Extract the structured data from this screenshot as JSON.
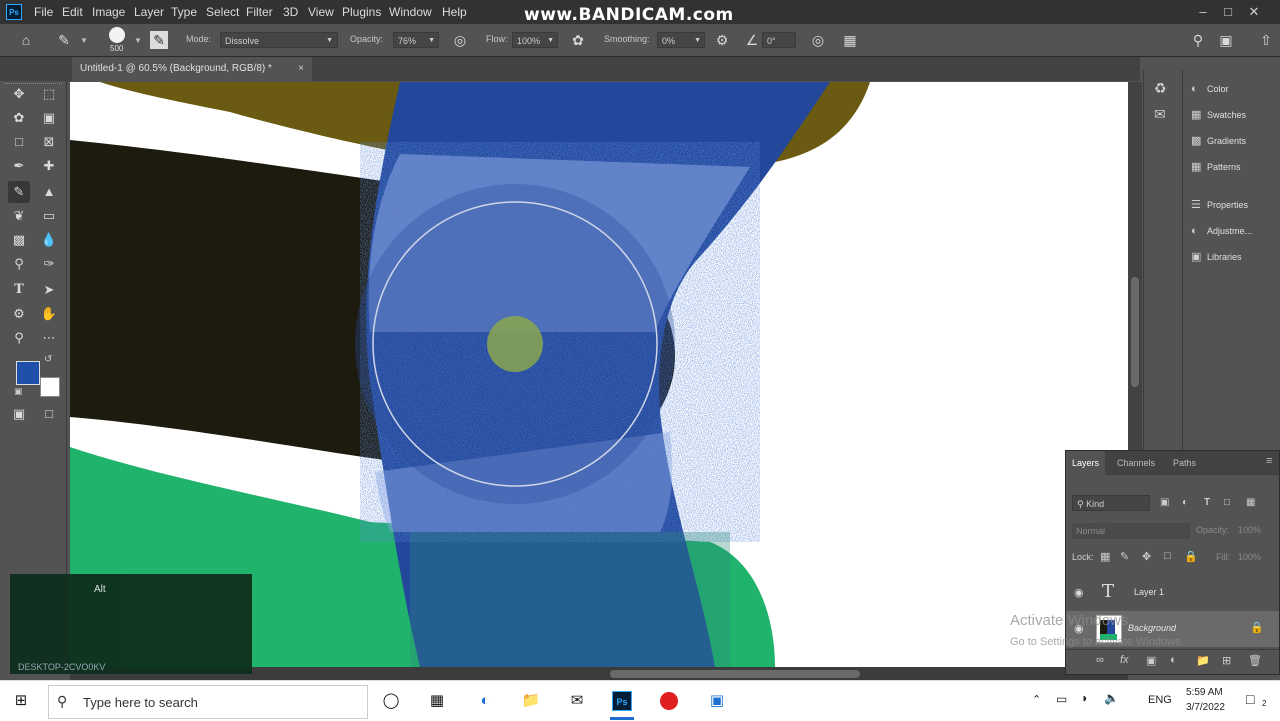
{
  "watermark": "www.BANDICAM.com",
  "menu": {
    "app_icon": "Ps",
    "items": [
      "File",
      "Edit",
      "Image",
      "Layer",
      "Type",
      "Select",
      "Filter",
      "3D",
      "View",
      "Plugins",
      "Window",
      "Help"
    ]
  },
  "options": {
    "brush_size": "500",
    "mode_label": "Mode:",
    "mode_value": "Dissolve",
    "opacity_label": "Opacity:",
    "opacity_value": "76%",
    "flow_label": "Flow:",
    "flow_value": "100%",
    "smoothing_label": "Smoothing:",
    "smoothing_value": "0%",
    "angle_value": "0°"
  },
  "document": {
    "tab_title": "Untitled-1 @ 60.5% (Background, RGB/8) *",
    "close": "×"
  },
  "colors": {
    "foreground": "#1f4fa8",
    "background": "#ffffff",
    "olive": "#6b5a12",
    "dark": "#1d1a0e",
    "green": "#1fb36b",
    "blue": "#23489b"
  },
  "panels": {
    "items": [
      {
        "label": "Color",
        "icon": "color-wheel-icon"
      },
      {
        "label": "Swatches",
        "icon": "swatches-grid-icon"
      },
      {
        "label": "Gradients",
        "icon": "gradients-icon"
      },
      {
        "label": "Patterns",
        "icon": "patterns-icon"
      },
      {
        "label": "Properties",
        "icon": "properties-icon"
      },
      {
        "label": "Adjustme...",
        "icon": "adjustments-icon"
      },
      {
        "label": "Libraries",
        "icon": "libraries-icon"
      }
    ]
  },
  "layers": {
    "tabs": [
      "Layers",
      "Channels",
      "Paths"
    ],
    "filter_kind": "Kind",
    "blend_mode": "Normal",
    "opacity_label": "Opacity:",
    "opacity_value": "100%",
    "lock_label": "Lock:",
    "fill_label": "Fill:",
    "fill_value": "100%",
    "rows": [
      {
        "name": "Layer 1",
        "type_glyph": "T"
      },
      {
        "name": "Background",
        "type_glyph": ""
      }
    ]
  },
  "overlay": {
    "alt_label": "Alt",
    "machine_name": "DESKTOP-2CVO0KV"
  },
  "activate": {
    "line1": "Activate Windows",
    "line2": "Go to Settings to activate Windows."
  },
  "taskbar": {
    "search_placeholder": "Type here to search",
    "lang": "ENG",
    "time": "5:59 AM",
    "date": "3/7/2022",
    "notifications": "2"
  }
}
